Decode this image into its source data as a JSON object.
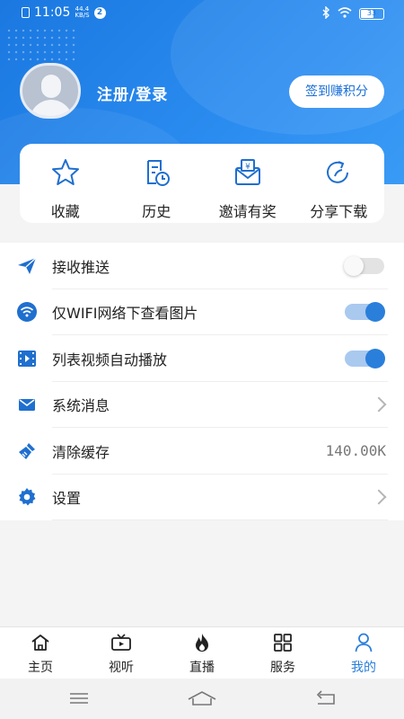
{
  "status_bar": {
    "time": "11:05",
    "speed_value": "44.4",
    "speed_unit": "KB/S",
    "notification_count": "2",
    "battery_level": "33"
  },
  "profile": {
    "login_label": "注册/登录",
    "sign_in_button": "签到赚积分"
  },
  "quick_actions": [
    {
      "label": "收藏",
      "icon": "star-icon"
    },
    {
      "label": "历史",
      "icon": "history-icon"
    },
    {
      "label": "邀请有奖",
      "icon": "invite-reward-icon"
    },
    {
      "label": "分享下载",
      "icon": "share-icon"
    }
  ],
  "settings": [
    {
      "label": "接收推送",
      "icon": "paper-plane-icon",
      "control": "toggle",
      "on": false
    },
    {
      "label": "仅WIFI网络下查看图片",
      "icon": "wifi-icon",
      "control": "toggle",
      "on": true
    },
    {
      "label": "列表视频自动播放",
      "icon": "video-icon",
      "control": "toggle",
      "on": true
    },
    {
      "label": "系统消息",
      "icon": "mail-icon",
      "control": "chevron"
    },
    {
      "label": "清除缓存",
      "icon": "broom-icon",
      "control": "value",
      "value": "140.00K"
    },
    {
      "label": "设置",
      "icon": "gear-icon",
      "control": "chevron"
    }
  ],
  "tabs": [
    {
      "label": "主页",
      "icon": "home-icon",
      "active": false
    },
    {
      "label": "视听",
      "icon": "tv-icon",
      "active": false
    },
    {
      "label": "直播",
      "icon": "flame-icon",
      "active": false
    },
    {
      "label": "服务",
      "icon": "grid-icon",
      "active": false
    },
    {
      "label": "我的",
      "icon": "user-icon",
      "active": true
    }
  ],
  "colors": {
    "accent": "#2a7fdb",
    "header_gradient_start": "#1a78e0",
    "header_gradient_end": "#3a9bf5"
  }
}
